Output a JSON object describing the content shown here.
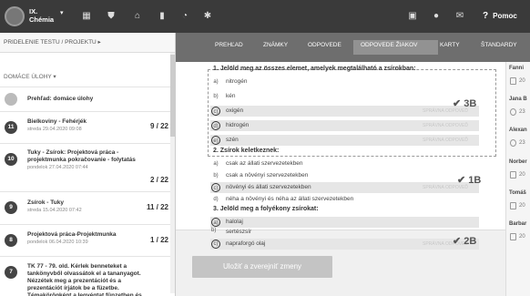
{
  "topbar": {
    "class_title": "IX.\nChémia",
    "help_label": "Pomoc",
    "icons": [
      "logo",
      "class-caret",
      "grid-icon",
      "shield-icon",
      "institution-icon",
      "chart-icon",
      "gauge-icon",
      "people-icon",
      "message-icon",
      "chat-icon",
      "mail-icon",
      "help-icon"
    ]
  },
  "sidebar": {
    "assign_link": "PRIDELENIE TESTU / PROJEKTU",
    "tasks_header": "DOMÁCE ÚLOHY",
    "tasks": [
      {
        "num": "",
        "title": "Prehľad: domáce úlohy",
        "date": "",
        "score": ""
      },
      {
        "num": "11",
        "title": "Bielkoviny - Fehérjék",
        "date": "streda 29.04.2020 09:08",
        "score": "9 / 22"
      },
      {
        "num": "10",
        "title": "Tuky - Zsírok: Projektová práca -\nprojektmunka pokračovanie - folytatás",
        "date": "pondelok 27.04.2020 07:44",
        "score": "2 / 22"
      },
      {
        "num": "9",
        "title": "Zsírok - Tuky",
        "date": "streda 15.04.2020 07:42",
        "score": "11 / 22"
      },
      {
        "num": "8",
        "title": "Projektová práca-Projektmunka",
        "date": "pondelok 06.04.2020 10:39",
        "score": "1 / 22"
      },
      {
        "num": "7",
        "title": "TK 77 - 79. old. Kérlek benneteket a\ntankönyvből olvassátok el a tananyagot.\nNézzétek meg a prezentációt és a\nprezentációt írjátok be a füzetbe.\nTémakörönként a legvégtat fünzetben és",
        "date": "",
        "score": ""
      }
    ]
  },
  "tabs": [
    "PREHĽAD",
    "ZNÁMKY",
    "ODPOVEDE",
    "ODPOVEDE ŽIAKOV",
    "KARTY",
    "ŠTANDARDY"
  ],
  "active_tab": "ODPOVEDE ŽIAKOV",
  "questions": [
    {
      "title": "1. Jelöld meg az összes elemet, amelyek megtalálható a zsírokban:",
      "score": "3B",
      "options": [
        {
          "letter": "a)",
          "text": "nitrogén",
          "selected": false,
          "status": ""
        },
        {
          "letter": "b)",
          "text": "kén",
          "selected": false,
          "status": ""
        },
        {
          "letter": "c)",
          "text": "oxigén",
          "selected": true,
          "status": "SPRÁVNA ODPOVEĎ"
        },
        {
          "letter": "d)",
          "text": "hidrogén",
          "selected": true,
          "status": "SPRÁVNA ODPOVEĎ"
        },
        {
          "letter": "e)",
          "text": "szén",
          "selected": true,
          "status": "SPRÁVNA ODPOVEĎ"
        }
      ]
    },
    {
      "title": "2. Zsírok keletkeznek:",
      "score": "1B",
      "options": [
        {
          "letter": "a)",
          "text": "csak az állati szervezetekben",
          "selected": false,
          "status": ""
        },
        {
          "letter": "b)",
          "text": "csak a növényi szervezetekben",
          "selected": false,
          "status": ""
        },
        {
          "letter": "c)",
          "text": "növényi és állati szervezetekben",
          "selected": true,
          "status": "SPRÁVNA ODPOVEĎ"
        },
        {
          "letter": "d)",
          "text": "néha a növényi és néha az állati szervezetekben",
          "selected": false,
          "status": ""
        }
      ]
    },
    {
      "title": "3. Jelöld meg a folyékony zsírokat:",
      "score": "2B",
      "options": [
        {
          "letter": "a)",
          "text": "halolaj",
          "selected": true,
          "status": ""
        },
        {
          "letter": "b)",
          "text": "sertészsír",
          "selected": false,
          "status": ""
        },
        {
          "letter": "c)",
          "text": "napraforgó olaj",
          "selected": true,
          "status": "SPRÁVNA ODPOVEĎ"
        }
      ]
    }
  ],
  "students": [
    {
      "name": "Fanni",
      "value": "20"
    },
    {
      "name": "Jana B",
      "value": "23"
    },
    {
      "name": "Alexan",
      "value": "23"
    },
    {
      "name": "Norber",
      "value": "20"
    },
    {
      "name": "Tomáš",
      "value": "20"
    },
    {
      "name": "Barbar",
      "value": "20"
    }
  ],
  "footer": {
    "save_label": "Uložiť a zverejniť zmeny"
  }
}
